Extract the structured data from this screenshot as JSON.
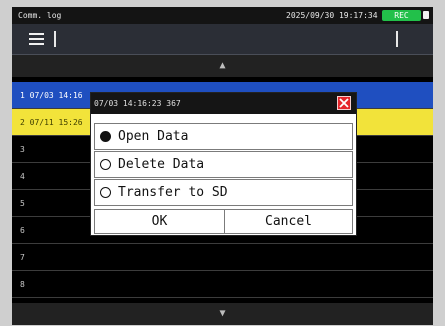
{
  "status": {
    "app_title": "Comm. log",
    "datetime": "2025/09/30 19:17:34",
    "rec_badge": "REC"
  },
  "rows": [
    {
      "label": "1 07/03 14:16",
      "state": "selected"
    },
    {
      "label": "2 07/11 15:26",
      "state": "highlighted"
    },
    {
      "label": "3",
      "state": "normal"
    },
    {
      "label": "4",
      "state": "normal"
    },
    {
      "label": "5",
      "state": "normal"
    },
    {
      "label": "6",
      "state": "normal"
    },
    {
      "label": "7",
      "state": "normal"
    },
    {
      "label": "8",
      "state": "normal"
    }
  ],
  "dialog": {
    "title": "07/03 14:16:23 367",
    "options": [
      {
        "label": "Open Data",
        "selected": true
      },
      {
        "label": "Delete Data",
        "selected": false
      },
      {
        "label": "Transfer to SD",
        "selected": false
      }
    ],
    "ok_label": "OK",
    "cancel_label": "Cancel"
  },
  "scroll": {
    "up_glyph": "▲",
    "down_glyph": "▼"
  },
  "colors": {
    "selected_row": "#1f4fc0",
    "highlight_row": "#f2e33a",
    "rec_badge": "#22c04a",
    "close_button": "#e5262b"
  }
}
